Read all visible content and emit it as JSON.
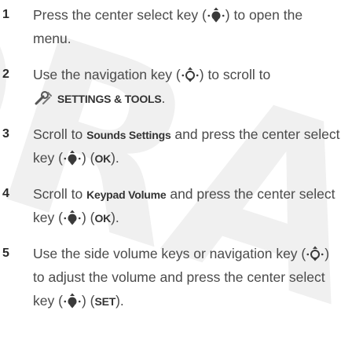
{
  "watermark": "DRA",
  "steps": [
    {
      "num": "1",
      "l1a": "Press the center select key (",
      "l1b": ") to open the",
      "l2": "menu."
    },
    {
      "num": "2",
      "l1a": "Use the navigation key (",
      "l1b": ") to scroll to",
      "l2": "SETTINGS & TOOLS",
      "l2b": "."
    },
    {
      "num": "3",
      "l1a": "Scroll to ",
      "l1b": "Sounds Settings",
      "l1c": " and press the center select",
      "l2a": "key (",
      "l2b": ") (",
      "l2c": "OK",
      "l2d": ")."
    },
    {
      "num": "4",
      "l1a": "Scroll to ",
      "l1b": "Keypad Volume",
      "l1c": " and press the center select",
      "l2a": "key (",
      "l2b": ") (",
      "l2c": "OK",
      "l2d": ")."
    },
    {
      "num": "5",
      "l1a": "Use the side volume keys or navigation key (",
      "l1b": ")",
      "l2": "to adjust the volume and press the center select",
      "l3a": "key (",
      "l3b": ") (",
      "l3c": "SET",
      "l3d": ")."
    }
  ]
}
